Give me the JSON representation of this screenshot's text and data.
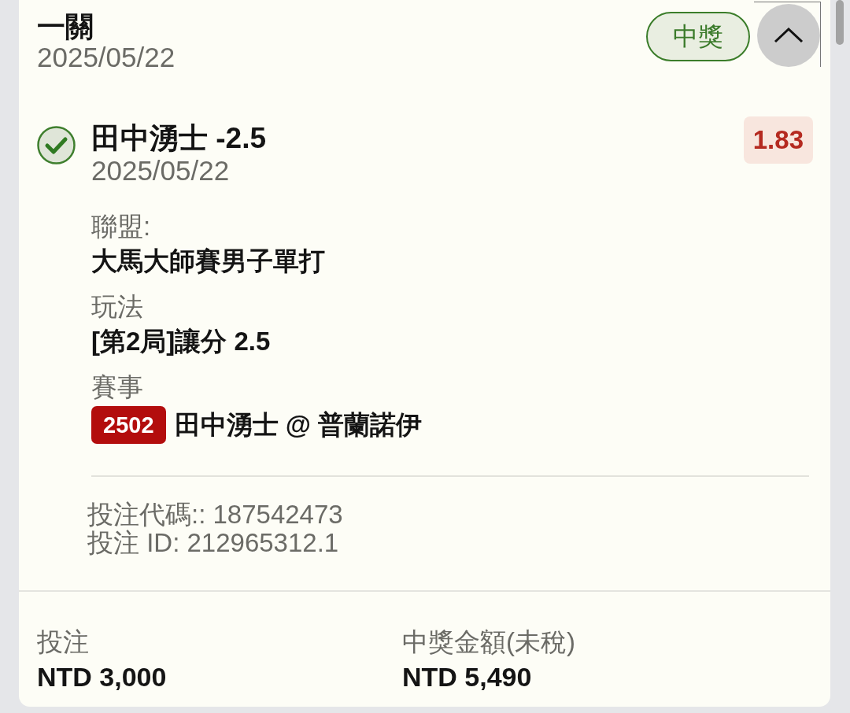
{
  "bet_card": {
    "title": "一關",
    "date": "2025/05/22",
    "status_badge": {
      "kind": "won",
      "label": "中獎"
    },
    "collapse_button": {
      "expanded": true
    }
  },
  "selections": [
    {
      "won": true,
      "name": "田中湧士 -2.5",
      "date": "2025/05/22",
      "odds": "1.83",
      "details": [
        {
          "kind": "text",
          "label": "聯盟:",
          "value": "大馬大師賽男子單打"
        },
        {
          "kind": "text",
          "label": "玩法",
          "value": "[第2局]讓分 2.5"
        },
        {
          "kind": "event",
          "label": "賽事",
          "event_code": "2502",
          "value": "田中湧士 @ 普蘭諾伊"
        }
      ],
      "bet_code": "投注代碼:: 187542473",
      "bet_id": "投注 ID: 212965312.1"
    }
  ],
  "summary": [
    {
      "label": "投注",
      "value": "NTD 3,000"
    },
    {
      "label": "中獎金額(未稅)",
      "value": "NTD 5,490"
    }
  ]
}
